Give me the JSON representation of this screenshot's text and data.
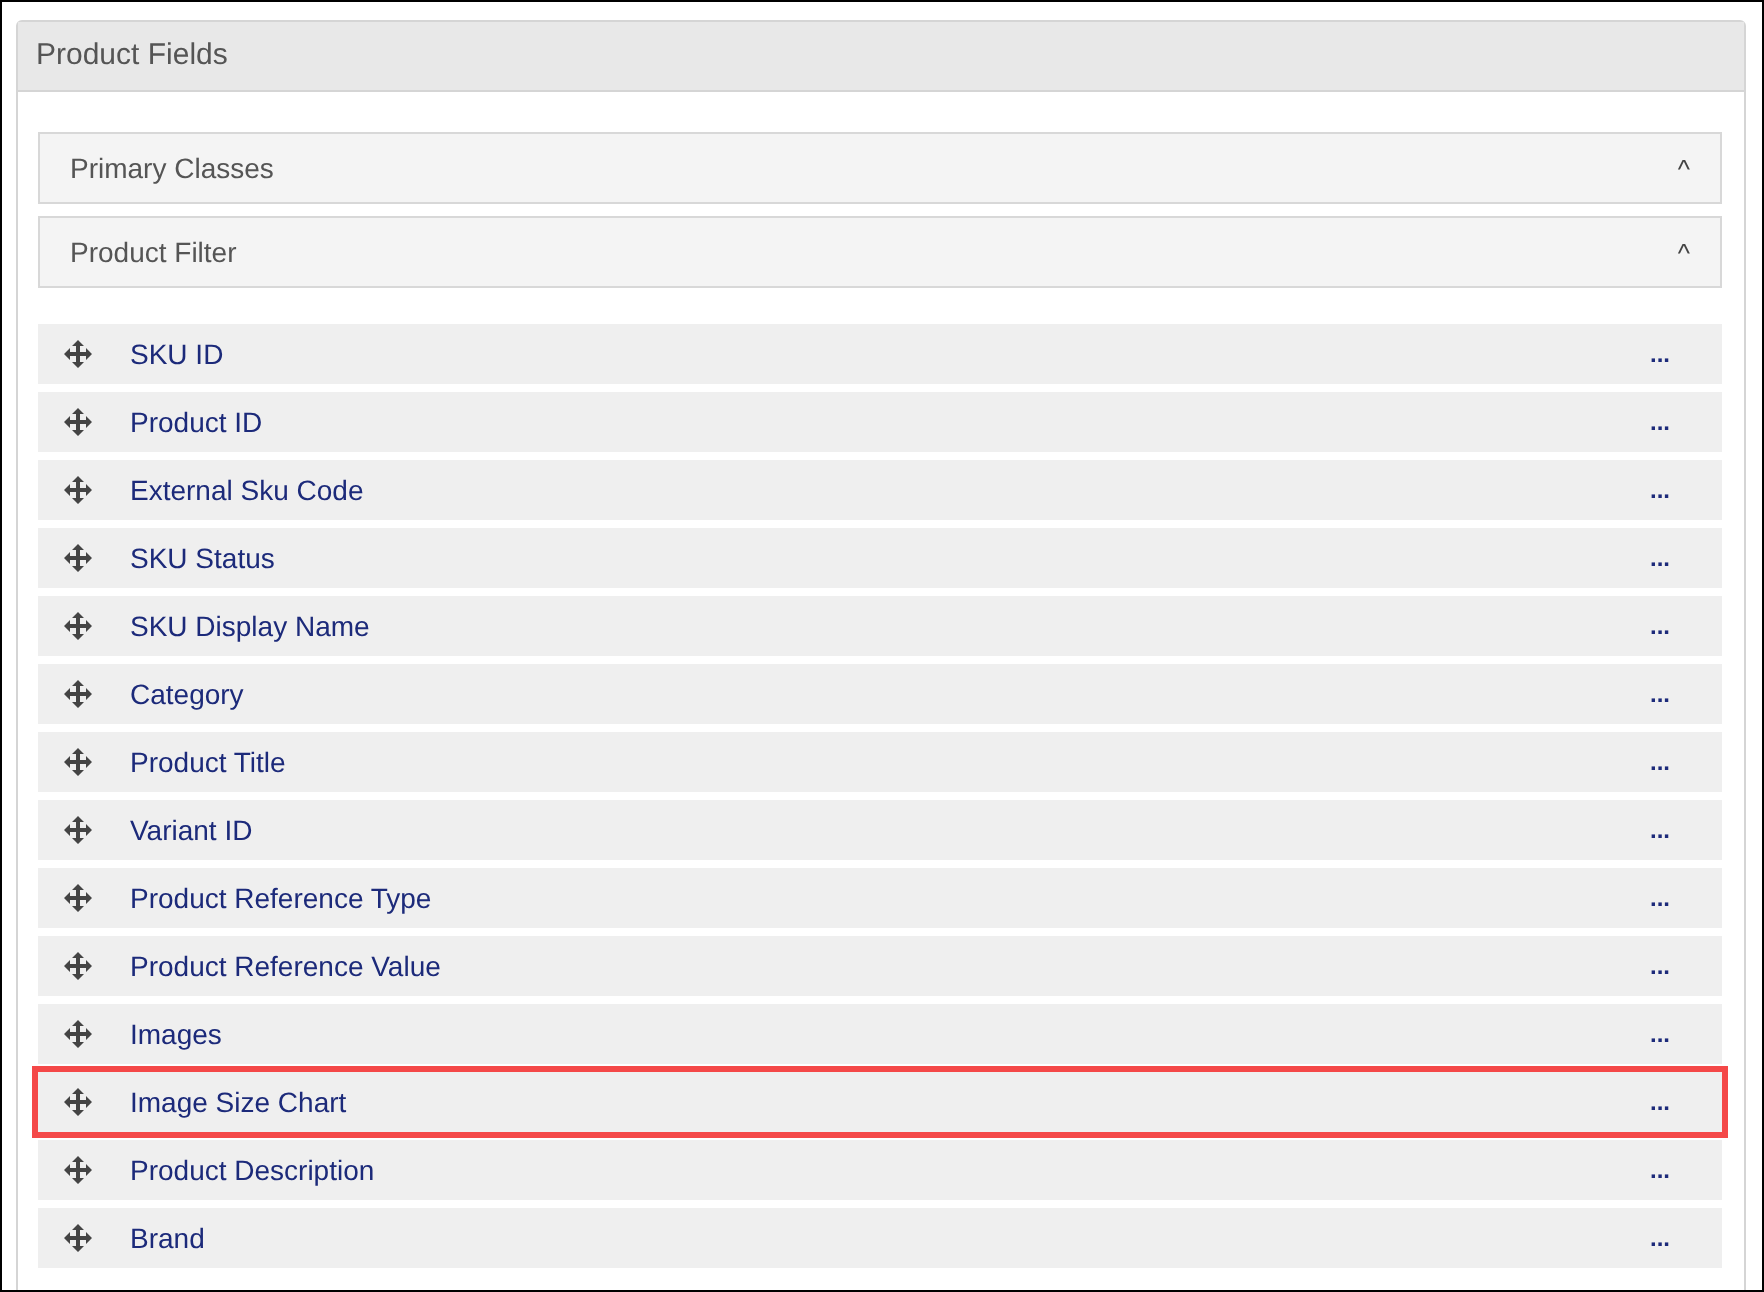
{
  "panel": {
    "title": "Product Fields"
  },
  "sections": [
    {
      "label": "Primary Classes",
      "expanded": true,
      "toggle": "^"
    },
    {
      "label": "Product Filter",
      "expanded": true,
      "toggle": "^"
    }
  ],
  "fields": [
    {
      "label": "SKU ID",
      "more": "...",
      "highlighted": false
    },
    {
      "label": "Product ID",
      "more": "...",
      "highlighted": false
    },
    {
      "label": "External Sku Code",
      "more": "...",
      "highlighted": false
    },
    {
      "label": "SKU Status",
      "more": "...",
      "highlighted": false
    },
    {
      "label": "SKU Display Name",
      "more": "...",
      "highlighted": false
    },
    {
      "label": "Category",
      "more": "...",
      "highlighted": false
    },
    {
      "label": "Product Title",
      "more": "...",
      "highlighted": false
    },
    {
      "label": "Variant ID",
      "more": "...",
      "highlighted": false
    },
    {
      "label": "Product Reference Type",
      "more": "...",
      "highlighted": false
    },
    {
      "label": "Product Reference Value",
      "more": "...",
      "highlighted": false
    },
    {
      "label": "Images",
      "more": "...",
      "highlighted": false
    },
    {
      "label": "Image Size Chart",
      "more": "...",
      "highlighted": true
    },
    {
      "label": "Product Description",
      "more": "...",
      "highlighted": false
    },
    {
      "label": "Brand",
      "more": "...",
      "highlighted": false
    }
  ]
}
